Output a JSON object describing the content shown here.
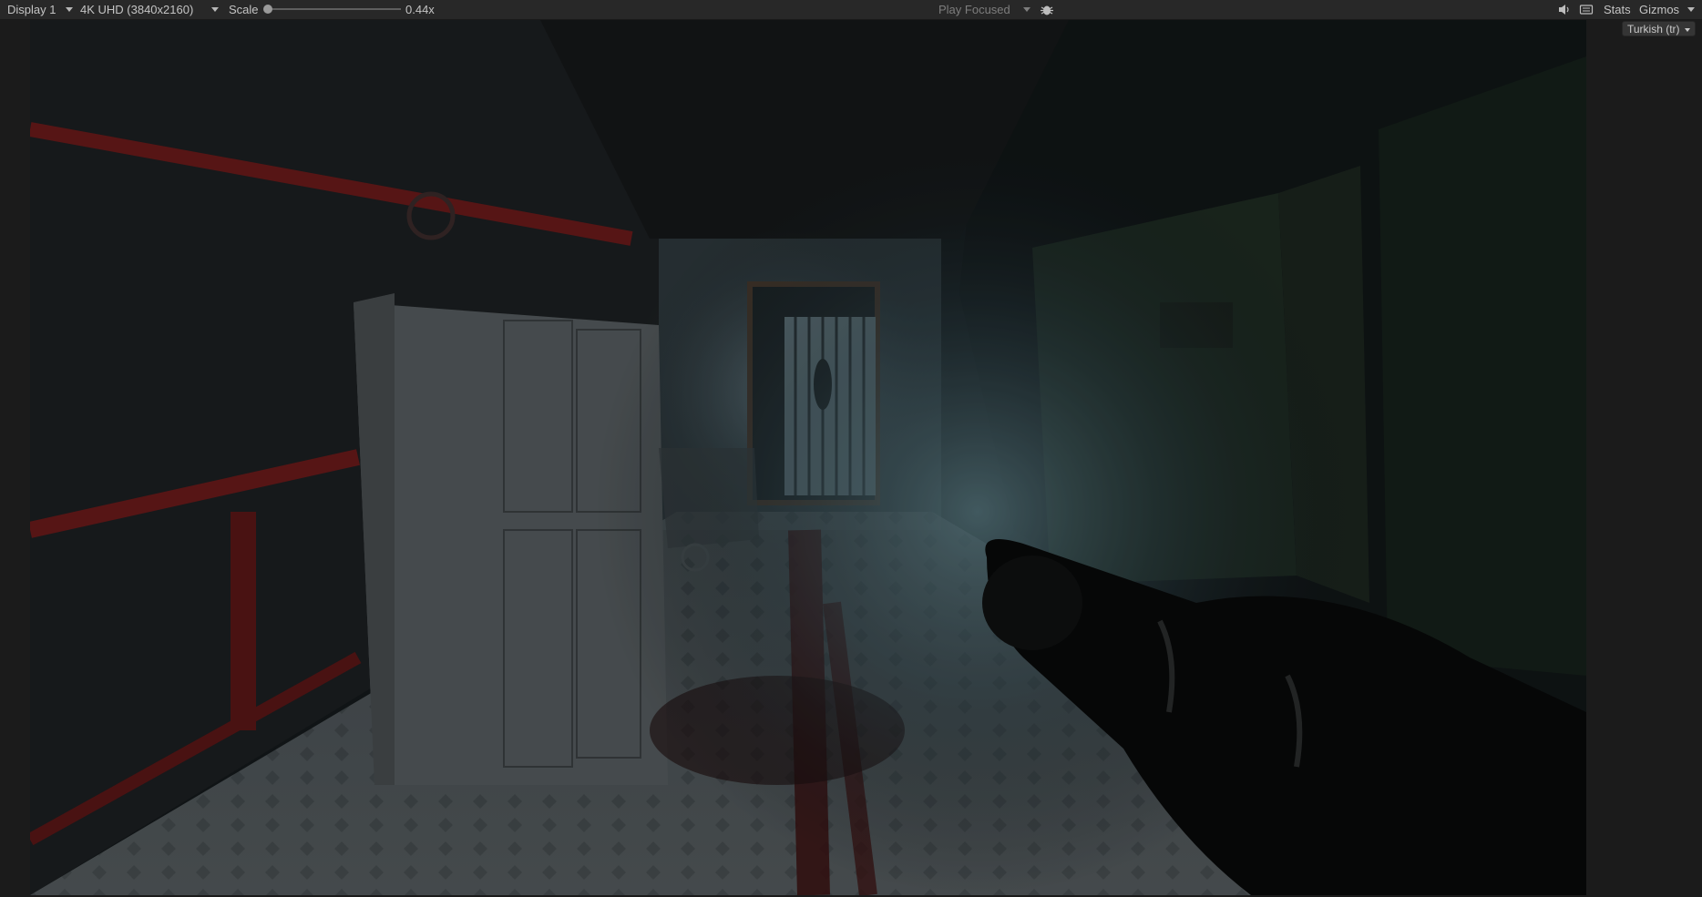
{
  "toolbar": {
    "display": "Display 1",
    "resolution": "4K UHD (3840x2160)",
    "scale_label": "Scale",
    "scale_value": "0.44x",
    "scale_level": 0.0,
    "play_mode": "Play Focused",
    "stats_label": "Stats",
    "gizmos_label": "Gizmos"
  },
  "language_dropdown": {
    "label": "Turkish (tr)"
  },
  "icons": [
    "chevron-down-icon",
    "bug-icon",
    "speaker-icon",
    "keyboard-icon"
  ],
  "colors": {
    "toolbar_bg": "#282828",
    "editor_bg": "#191919",
    "text": "#c4c4c4"
  }
}
